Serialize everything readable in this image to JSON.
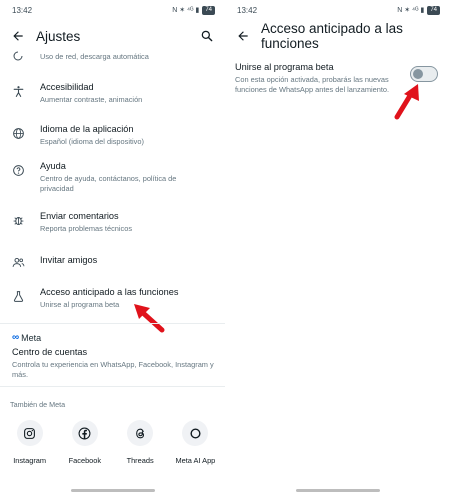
{
  "left": {
    "status": {
      "time": "13:42",
      "icons": "N ✶ ⁴ᴳ ▮",
      "battery": "74"
    },
    "appbar": {
      "title": "Ajustes"
    },
    "items": [
      {
        "title": "",
        "subtitle": "Uso de red, descarga automática"
      },
      {
        "title": "Accesibilidad",
        "subtitle": "Aumentar contraste, animación"
      },
      {
        "title": "Idioma de la aplicación",
        "subtitle": "Español (idioma del dispositivo)"
      },
      {
        "title": "Ayuda",
        "subtitle": "Centro de ayuda, contáctanos, política de privacidad"
      },
      {
        "title": "Enviar comentarios",
        "subtitle": "Reporta problemas técnicos"
      },
      {
        "title": "Invitar amigos",
        "subtitle": ""
      },
      {
        "title": "Acceso anticipado a las funciones",
        "subtitle": "Unirse al programa beta"
      }
    ],
    "meta": {
      "logo": "Meta",
      "title": "Centro de cuentas",
      "subtitle": "Controla tu experiencia en WhatsApp, Facebook, Instagram y más."
    },
    "also_label": "También de Meta",
    "apps": [
      {
        "label": "Instagram",
        "icon": "instagram-icon"
      },
      {
        "label": "Facebook",
        "icon": "facebook-icon"
      },
      {
        "label": "Threads",
        "icon": "threads-icon"
      },
      {
        "label": "Meta AI App",
        "icon": "meta-ai-icon"
      }
    ]
  },
  "right": {
    "status": {
      "time": "13:42",
      "icons": "N ✶ ⁴ᴳ ▮",
      "battery": "74"
    },
    "appbar": {
      "title": "Acceso anticipado a las funciones"
    },
    "beta": {
      "title": "Unirse al programa beta",
      "subtitle": "Con esta opción activada, probarás las nuevas funciones de WhatsApp antes del lanzamiento.",
      "enabled": false
    }
  },
  "colors": {
    "arrow": "#e0121b",
    "meta_blue": "#0064e0",
    "toggle_off": "#8696a0"
  }
}
